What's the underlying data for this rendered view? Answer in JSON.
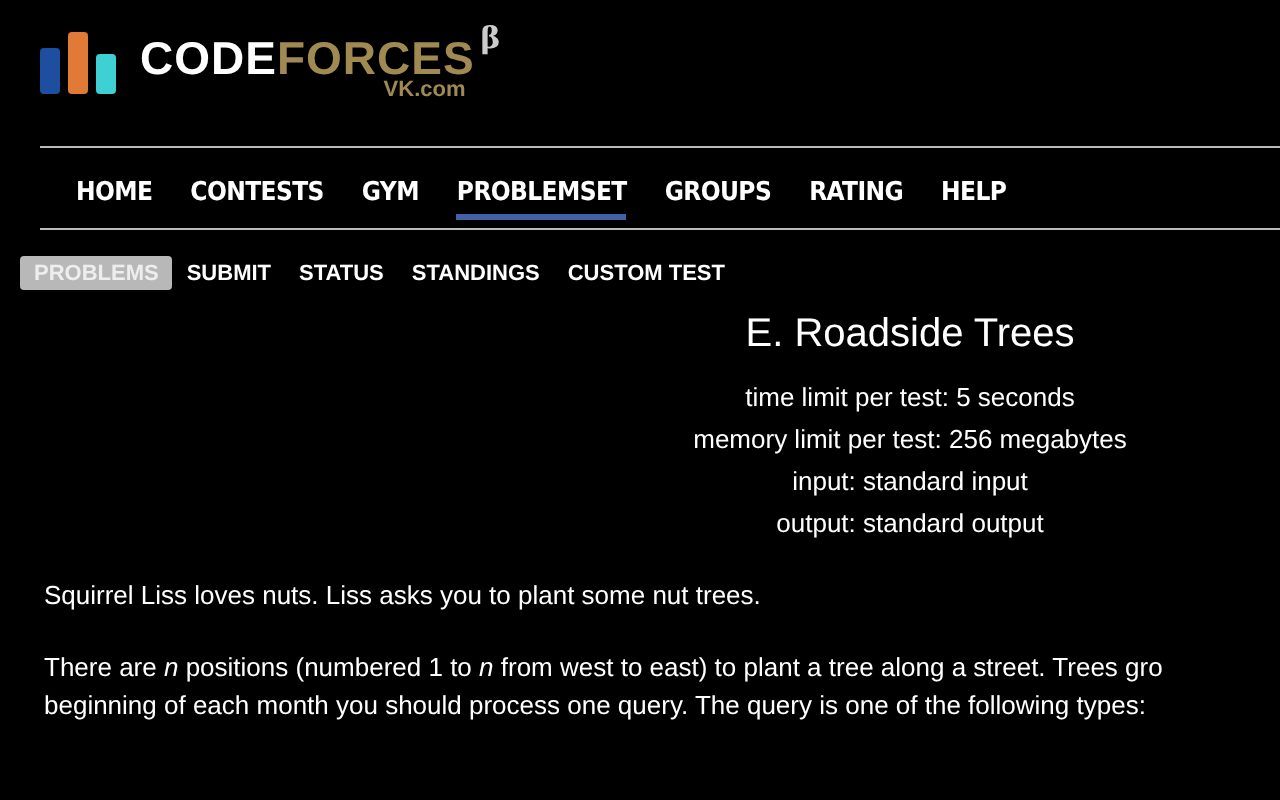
{
  "logo": {
    "name_first": "CODE",
    "name_second": "FORCES",
    "superscript": "β",
    "subtitle": "VK.com"
  },
  "menu": [
    {
      "label": "HOME",
      "selected": false
    },
    {
      "label": "CONTESTS",
      "selected": false
    },
    {
      "label": "GYM",
      "selected": false
    },
    {
      "label": "PROBLEMSET",
      "selected": true
    },
    {
      "label": "GROUPS",
      "selected": false
    },
    {
      "label": "RATING",
      "selected": false
    },
    {
      "label": "HELP",
      "selected": false
    }
  ],
  "submenu": [
    {
      "label": "PROBLEMS",
      "selected": true
    },
    {
      "label": "SUBMIT",
      "selected": false
    },
    {
      "label": "STATUS",
      "selected": false
    },
    {
      "label": "STANDINGS",
      "selected": false
    },
    {
      "label": "CUSTOM TEST",
      "selected": false
    }
  ],
  "problem": {
    "title": "E. Roadside Trees",
    "limits": [
      "time limit per test: 5 seconds",
      "memory limit per test: 256 megabytes",
      "input: standard input",
      "output: standard output"
    ],
    "paragraphs": [
      [
        "Squirrel Liss loves nuts. Liss asks you to plant some nut trees."
      ],
      [
        "There are *n* positions (numbered 1 to *n* from west to east) to plant a tree along a street. Trees gro",
        "beginning of each month you should process one query. The query is one of the following types:"
      ]
    ]
  }
}
